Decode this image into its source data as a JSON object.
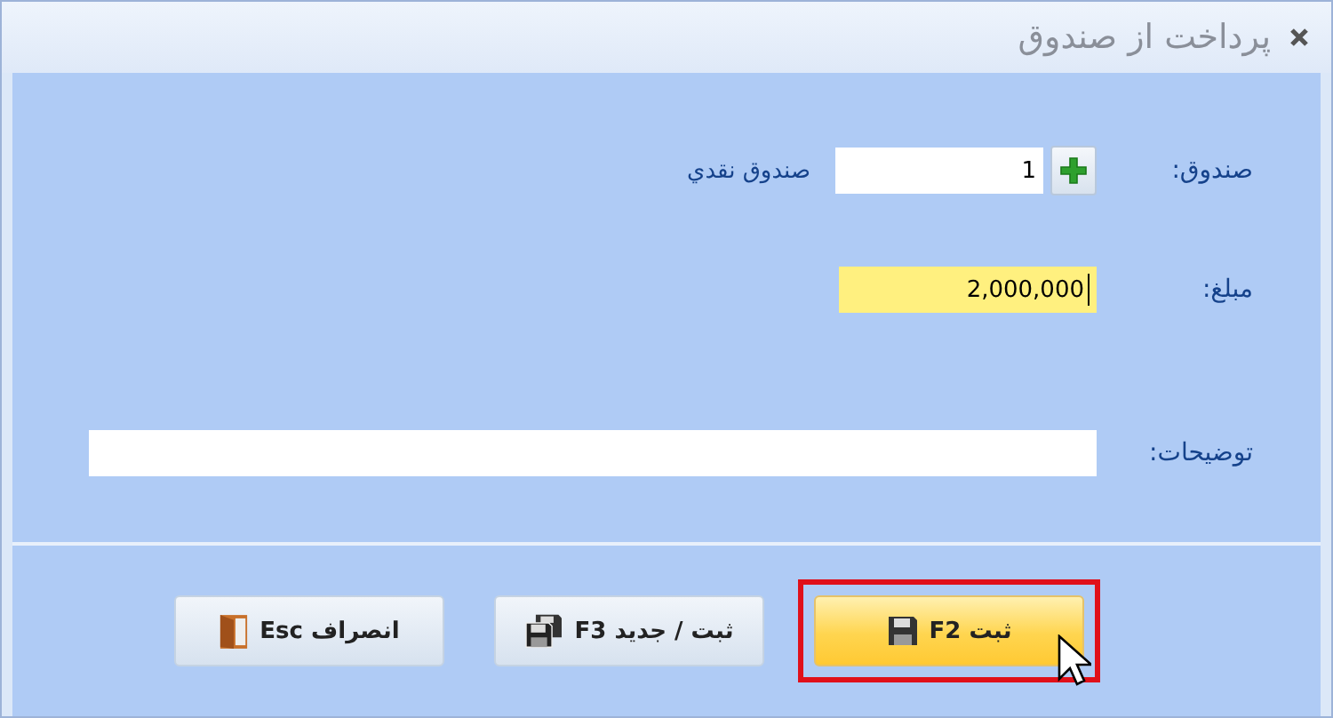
{
  "window": {
    "title": "پرداخت از صندوق"
  },
  "fields": [
    {
      "label": "صندوق:",
      "kind": "lookup",
      "value": "1",
      "note": "صندوق نقدي",
      "focused": false
    },
    {
      "label": "مبلغ:",
      "kind": "amount",
      "value": "2,000,000",
      "focused": true
    },
    {
      "label": "توضيحات:",
      "kind": "text",
      "focused": false
    }
  ],
  "buttons": [
    {
      "label": "ثبت F2",
      "kind": "save",
      "selected": true
    },
    {
      "label": "ثبت / جدید F3",
      "kind": "save_new",
      "selected": false
    },
    {
      "label": "انصراف Esc",
      "kind": "cancel",
      "selected": false
    }
  ]
}
